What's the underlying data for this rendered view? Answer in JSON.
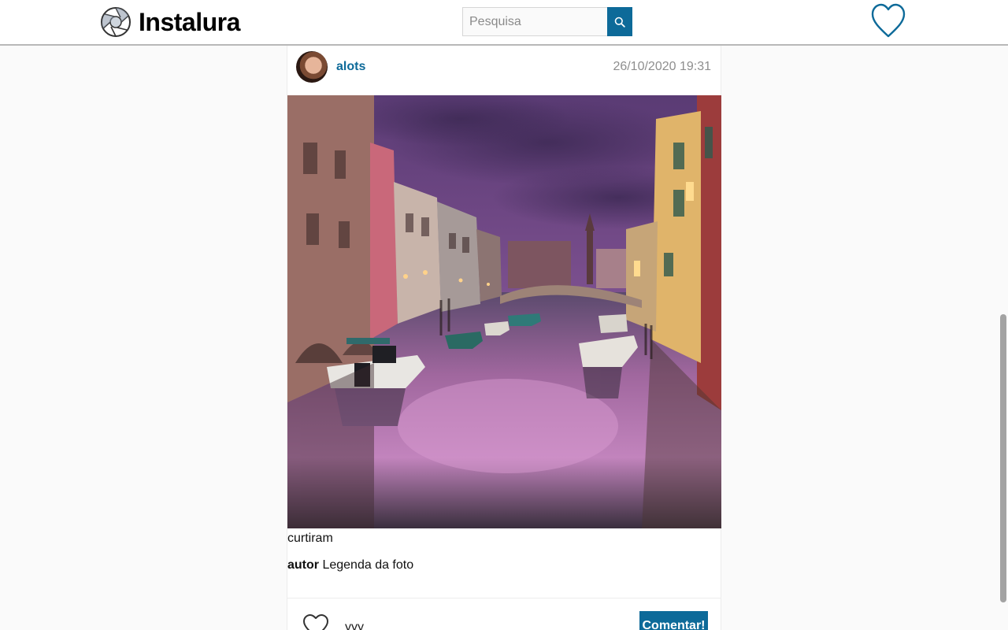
{
  "header": {
    "brand": "Instalura",
    "logo_icon": "camera-shutter-icon",
    "search": {
      "placeholder": "Pesquisa",
      "value": ""
    },
    "search_icon": "search-icon",
    "favorites_icon": "heart-icon"
  },
  "post": {
    "author": "alots",
    "timestamp": "26/10/2020 19:31",
    "photo_description_icon": "venice-canal-photo",
    "likers_label": "curtiram",
    "caption": {
      "author": "autor",
      "text": "Legenda da foto"
    },
    "comment": {
      "value": "yyy",
      "submit_label": "Comentar!",
      "like_icon": "heart-icon"
    }
  },
  "colors": {
    "accent": "#0d6a99",
    "background": "#fafafa"
  }
}
